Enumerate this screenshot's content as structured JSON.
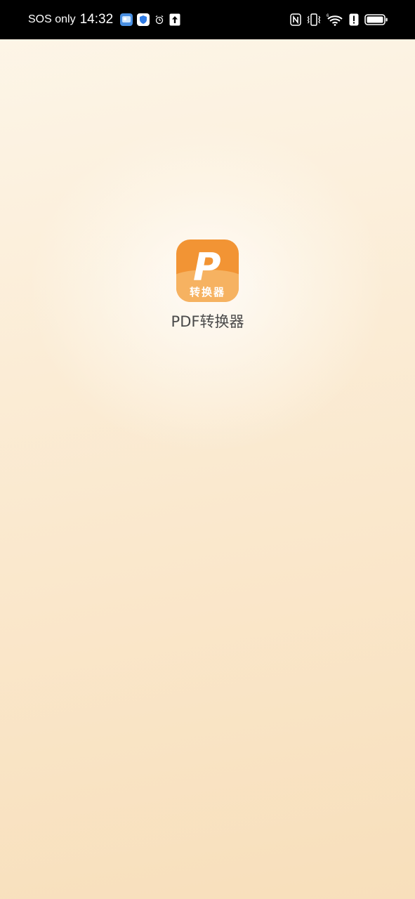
{
  "status_bar": {
    "carrier": "SOS only",
    "time": "14:32",
    "left_icons": [
      "weather-app-icon",
      "security-shield-icon",
      "alarm-icon",
      "upload-arrow-icon"
    ],
    "right_icons": [
      "nfc-icon",
      "vibrate-icon",
      "wifi-6-icon",
      "alert-icon",
      "battery-icon"
    ],
    "wifi_badge": "6"
  },
  "splash": {
    "app_name": "PDF转换器",
    "icon_letter": "P",
    "icon_caption": "转换器",
    "colors": {
      "icon_primary": "#f29434",
      "icon_band": "#f6b261",
      "background_top": "#fdf6e9",
      "background_bottom": "#f8dfbb",
      "app_name_text": "#4a4a4a"
    }
  }
}
